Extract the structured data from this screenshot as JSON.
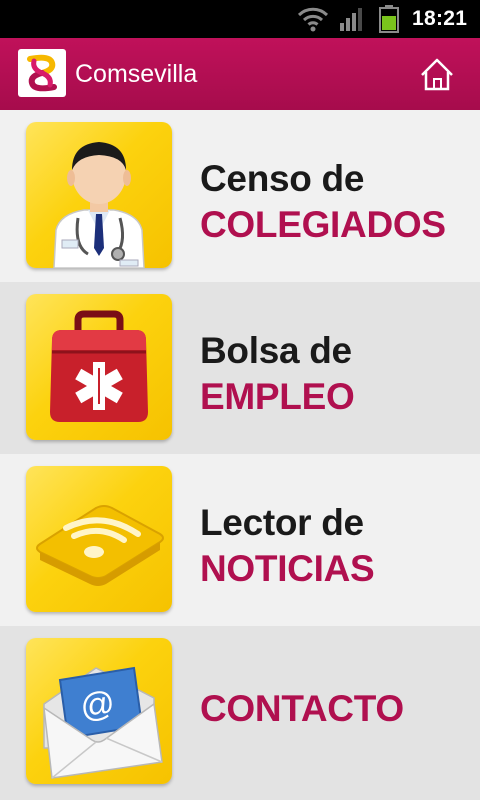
{
  "status_bar": {
    "time": "18:21"
  },
  "app": {
    "title": "Comsevilla"
  },
  "menu": [
    {
      "line1": "Censo de",
      "line2": "COLEGIADOS",
      "icon": "doctor-icon"
    },
    {
      "line1": "Bolsa de",
      "line2": "EMPLEO",
      "icon": "first-aid-kit-icon"
    },
    {
      "line1": "Lector de",
      "line2": "NOTICIAS",
      "icon": "rss-feed-icon"
    },
    {
      "line1": "",
      "line2": "CONTACTO",
      "icon": "email-envelope-icon"
    }
  ],
  "colors": {
    "action_bar": "#b0104f",
    "accent_text": "#b0104f",
    "tile": "#fcd20e"
  }
}
